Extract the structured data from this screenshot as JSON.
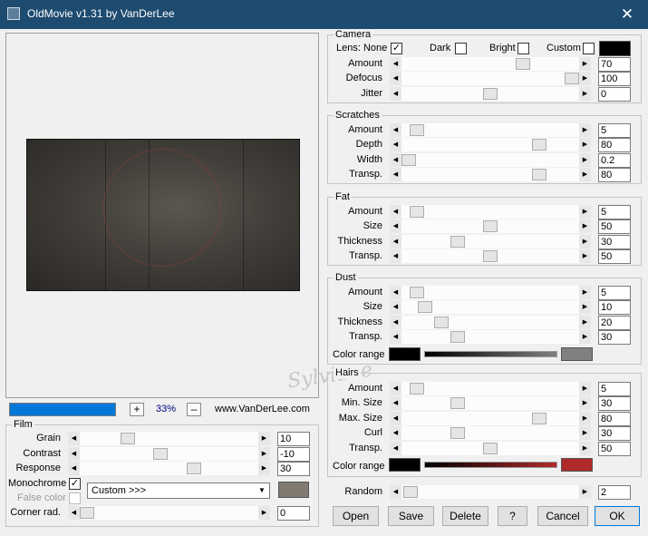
{
  "window": {
    "title": "OldMovie v1.31 by VanDerLee",
    "close_glyph": "✕"
  },
  "preview": {
    "watermark": "Sylviane",
    "progress": 1.0,
    "zoom": "33%",
    "zoom_in": "+",
    "zoom_out": "–",
    "website": "www.VanDerLee.com"
  },
  "arrows": {
    "left": "◀",
    "right": "▶"
  },
  "camera": {
    "label": "Camera",
    "lens_label": "Lens: None",
    "lens_checked": "✓",
    "dark_label": "Dark",
    "bright_label": "Bright",
    "custom_label": "Custom",
    "custom_color": "#000000",
    "sliders": [
      {
        "label": "Amount",
        "value": "70",
        "pos": 0.7
      },
      {
        "label": "Defocus",
        "value": "100",
        "pos": 1.0
      },
      {
        "label": "Jitter",
        "value": "0",
        "pos": 0.5
      }
    ]
  },
  "scratches": {
    "label": "Scratches",
    "sliders": [
      {
        "label": "Amount",
        "value": "5",
        "pos": 0.05
      },
      {
        "label": "Depth",
        "value": "80",
        "pos": 0.8
      },
      {
        "label": "Width",
        "value": "0.2",
        "pos": 0.0
      },
      {
        "label": "Transp.",
        "value": "80",
        "pos": 0.8
      }
    ]
  },
  "fat": {
    "label": "Fat",
    "sliders": [
      {
        "label": "Amount",
        "value": "5",
        "pos": 0.05
      },
      {
        "label": "Size",
        "value": "50",
        "pos": 0.5
      },
      {
        "label": "Thickness",
        "value": "30",
        "pos": 0.3
      },
      {
        "label": "Transp.",
        "value": "50",
        "pos": 0.5
      }
    ]
  },
  "dust": {
    "label": "Dust",
    "sliders": [
      {
        "label": "Amount",
        "value": "5",
        "pos": 0.05
      },
      {
        "label": "Size",
        "value": "10",
        "pos": 0.1
      },
      {
        "label": "Thickness",
        "value": "20",
        "pos": 0.2
      },
      {
        "label": "Transp.",
        "value": "30",
        "pos": 0.3
      }
    ],
    "color_range_label": "Color range",
    "color_start": "#000000",
    "color_end": "#808080"
  },
  "hairs": {
    "label": "Hairs",
    "sliders": [
      {
        "label": "Amount",
        "value": "5",
        "pos": 0.05
      },
      {
        "label": "Min. Size",
        "value": "30",
        "pos": 0.3
      },
      {
        "label": "Max. Size",
        "value": "80",
        "pos": 0.8
      },
      {
        "label": "Curl",
        "value": "30",
        "pos": 0.3
      },
      {
        "label": "Transp.",
        "value": "50",
        "pos": 0.5
      }
    ],
    "color_range_label": "Color range",
    "color_start": "#000000",
    "color_end": "#b02a2a"
  },
  "film": {
    "label": "Film",
    "sliders": [
      {
        "label": "Grain",
        "value": "10",
        "pos": 0.25
      },
      {
        "label": "Contrast",
        "value": "-10",
        "pos": 0.45
      },
      {
        "label": "Response",
        "value": "30",
        "pos": 0.65
      }
    ],
    "monochrome_label": "Monochrome",
    "monochrome_checked": "✓",
    "false_color_label": "False color",
    "mono_preset": "Custom >>>",
    "mono_dd": "▼",
    "mono_color": "#817a70",
    "corner": {
      "label": "Corner rad.",
      "value": "0",
      "pos": 0.0
    }
  },
  "random": {
    "label": "Random",
    "value": "2",
    "pos": 0.01
  },
  "buttons": {
    "open": "Open",
    "save": "Save",
    "delete": "Delete",
    "help": "?",
    "cancel": "Cancel",
    "ok": "OK"
  }
}
